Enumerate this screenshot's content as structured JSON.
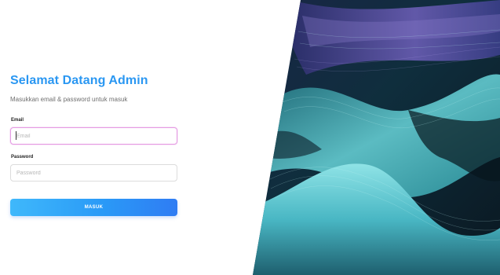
{
  "login": {
    "title": "Selamat Datang Admin",
    "subtitle": "Masukkan email & password untuk masuk",
    "email": {
      "label": "Email",
      "placeholder": "Email",
      "value": ""
    },
    "password": {
      "label": "Password",
      "placeholder": "Password",
      "value": ""
    },
    "submit_label": "MASUK"
  },
  "colors": {
    "title": "#2a97f2",
    "button_gradient_start": "#3fb8fb",
    "button_gradient_end": "#2f7cf3",
    "email_focus_border": "#e59be3"
  },
  "hero": {
    "icon": "abstract-wave-art"
  }
}
